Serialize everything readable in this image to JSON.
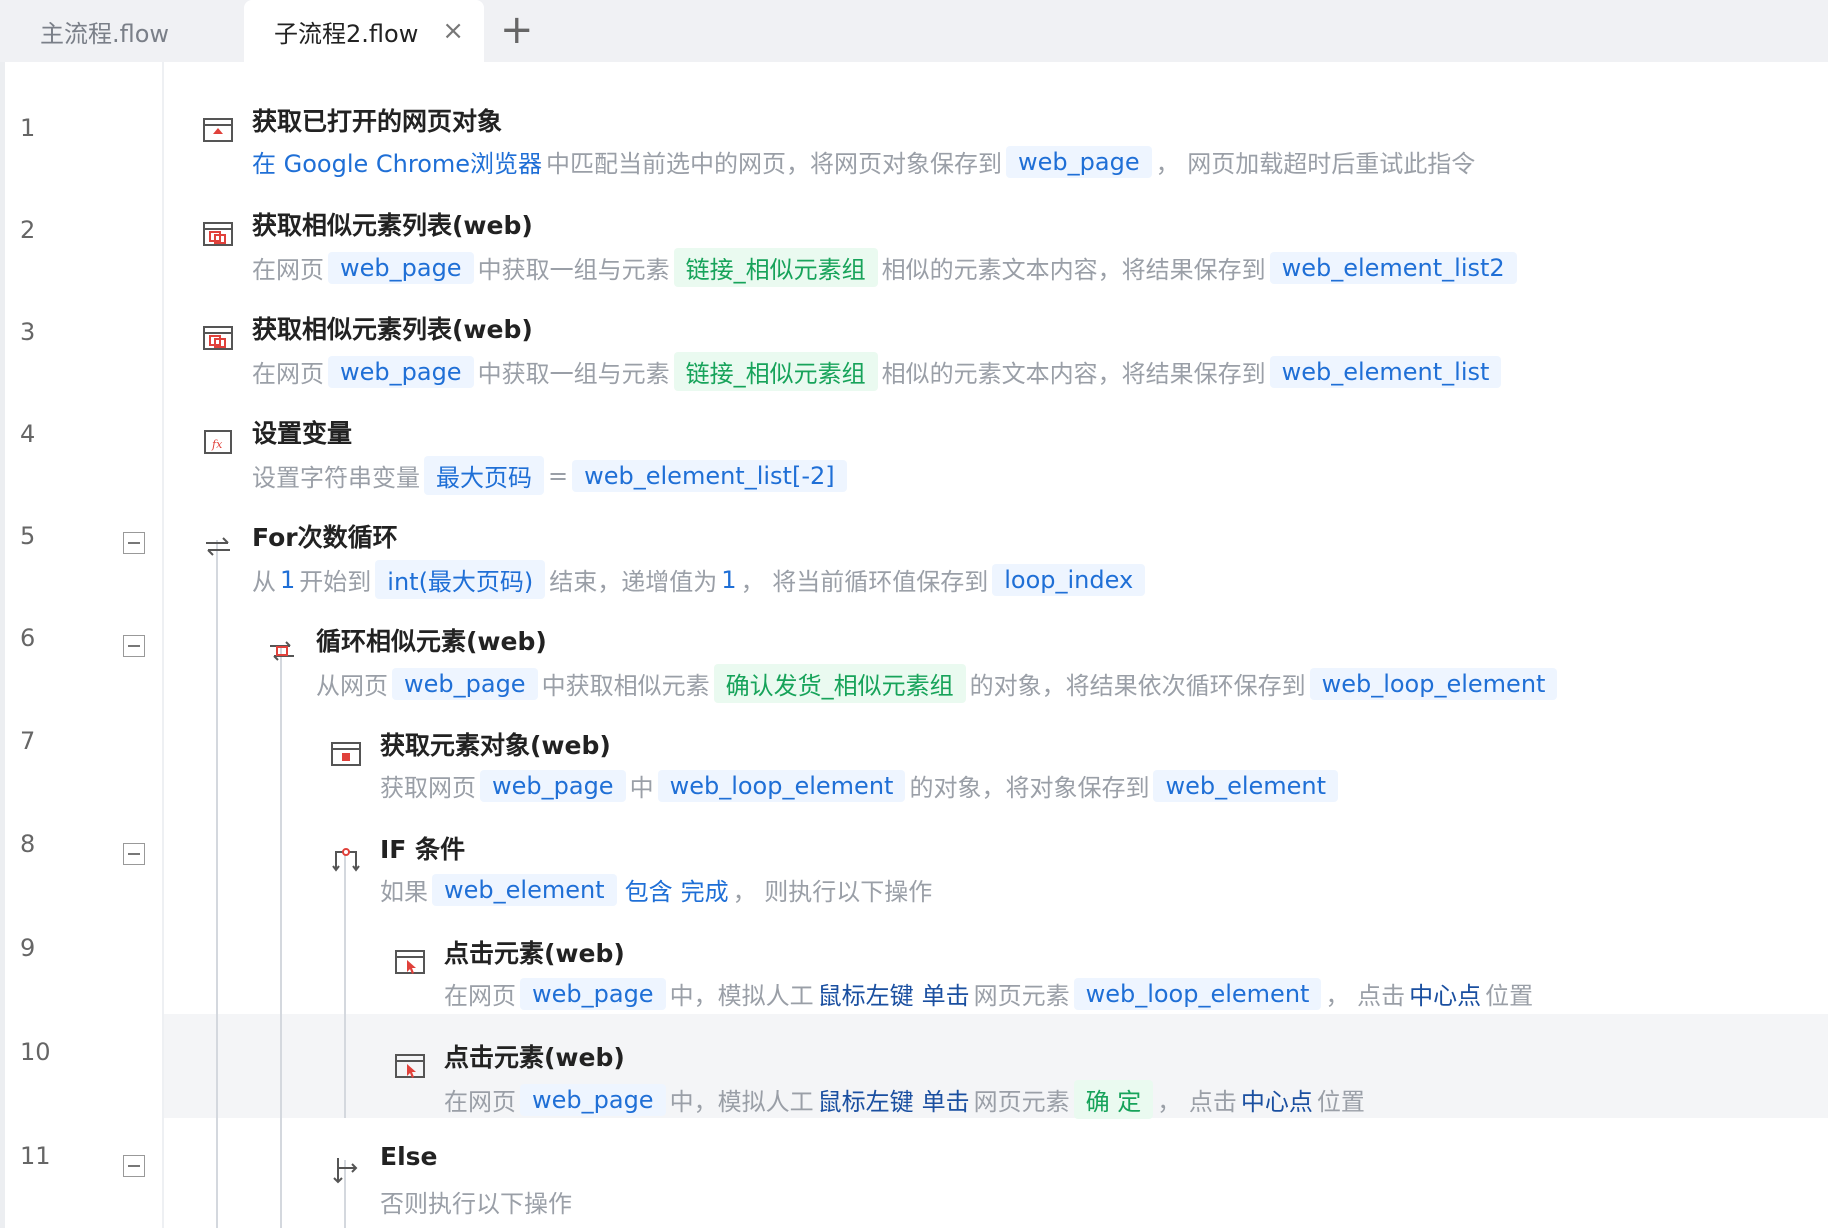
{
  "tabs": [
    {
      "label": "主流程.flow"
    },
    {
      "label": "子流程2.flow",
      "close": "×"
    }
  ],
  "add_tab": "+",
  "rows": [
    {
      "no": "1",
      "title": "获取已打开的网页对象",
      "d0": "在 Google Chrome浏览器",
      "d1": "中匹配当前选中的网页，将网页对象保存到",
      "d2": "web_page",
      "d3": "， 网页加载超时后重试此指令"
    },
    {
      "no": "2",
      "title": "获取相似元素列表(web)",
      "d0": "在网页",
      "d1": "web_page",
      "d2": "中获取一组与元素",
      "d3": "链接_相似元素组",
      "d4": "相似的元素文本内容，将结果保存到",
      "d5": "web_element_list2"
    },
    {
      "no": "3",
      "title": "获取相似元素列表(web)",
      "d0": "在网页",
      "d1": "web_page",
      "d2": "中获取一组与元素",
      "d3": "链接_相似元素组",
      "d4": "相似的元素文本内容，将结果保存到",
      "d5": "web_element_list"
    },
    {
      "no": "4",
      "title": "设置变量",
      "d0": "设置字符串变量",
      "d1": "最大页码",
      "d2": "=",
      "d3": "web_element_list[-2]"
    },
    {
      "no": "5",
      "title": "For次数循环",
      "d0": "从",
      "d1": "1",
      "d2": "开始到",
      "d3": "int(最大页码)",
      "d4": "结束，递增值为",
      "d5": "1",
      "d6": "，  将当前循环值保存到",
      "d7": "loop_index"
    },
    {
      "no": "6",
      "title": "循环相似元素(web)",
      "d0": "从网页",
      "d1": "web_page",
      "d2": "中获取相似元素",
      "d3": "确认发货_相似元素组",
      "d4": "的对象，将结果依次循环保存到",
      "d5": "web_loop_element"
    },
    {
      "no": "7",
      "title": "获取元素对象(web)",
      "d0": "获取网页",
      "d1": "web_page",
      "d2": "中",
      "d3": "web_loop_element",
      "d4": "的对象，将对象保存到",
      "d5": "web_element"
    },
    {
      "no": "8",
      "title": "IF 条件",
      "d0": "如果",
      "d1": "web_element",
      "d2": "包含",
      "d3": "完成",
      "d4": "，  则执行以下操作"
    },
    {
      "no": "9",
      "title": "点击元素(web)",
      "d0": "在网页",
      "d1": "web_page",
      "d2": "中，模拟人工",
      "d3": "鼠标左键",
      "d4": "单击",
      "d5": "网页元素",
      "d6": "web_loop_element",
      "d7": "，  点击",
      "d8": "中心点",
      "d9": "位置"
    },
    {
      "no": "10",
      "title": "点击元素(web)",
      "d0": "在网页",
      "d1": "web_page",
      "d2": "中，模拟人工",
      "d3": "鼠标左键",
      "d4": "单击",
      "d5": "网页元素",
      "d6": "确 定",
      "d7": "，  点击",
      "d8": "中心点",
      "d9": "位置"
    },
    {
      "no": "11",
      "title": "Else",
      "d0": "否则执行以下操作"
    }
  ],
  "colors": {
    "var_bg": "#eef5ff",
    "var_fg": "#1f6fd6",
    "elem_bg": "#eafaf0",
    "elem_fg": "#17a35a",
    "highlight": "#f4f5f7"
  },
  "icons": [
    "browser-open-icon",
    "similar-list-icon",
    "similar-list-icon",
    "fx-variable-icon",
    "loop-arrows-icon",
    "loop-element-icon",
    "element-object-icon",
    "if-branch-icon",
    "click-element-icon",
    "click-element-icon",
    "else-branch-icon"
  ]
}
